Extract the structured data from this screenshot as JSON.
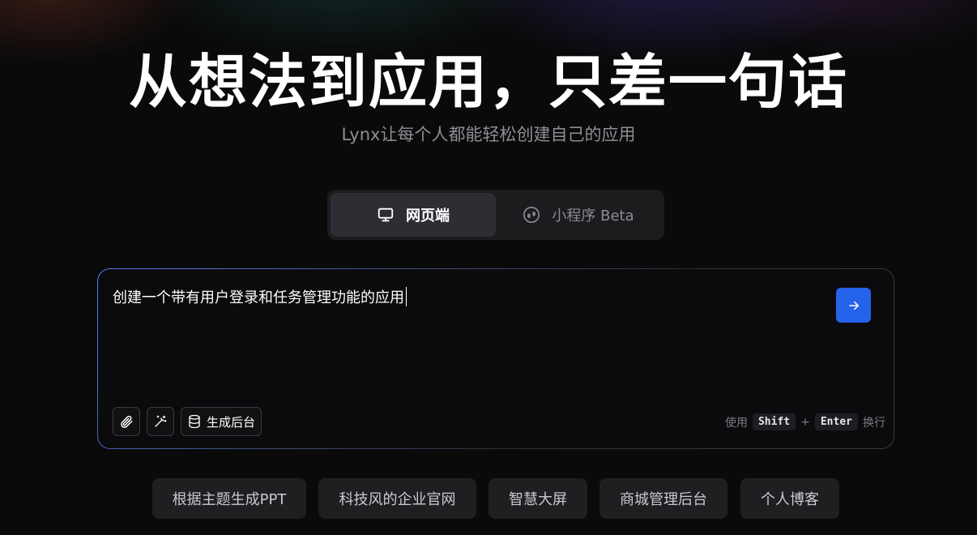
{
  "hero": {
    "title": "从想法到应用，只差一句话",
    "subtitle": "Lynx让每个人都能轻松创建自己的应用"
  },
  "mode_switch": {
    "tabs": [
      {
        "label": "网页端",
        "icon": "monitor-icon",
        "active": true
      },
      {
        "label": "小程序 Beta",
        "icon": "miniprogram-icon",
        "active": false
      }
    ]
  },
  "prompt": {
    "value": "创建一个带有用户登录和任务管理功能的应用",
    "tools": [
      {
        "icon": "paperclip-icon",
        "label": ""
      },
      {
        "icon": "magic-wand-icon",
        "label": ""
      },
      {
        "icon": "database-icon",
        "label": "生成后台"
      }
    ],
    "hint": {
      "prefix": "使用",
      "key1": "Shift",
      "plus": "+",
      "key2": "Enter",
      "suffix": "换行"
    }
  },
  "suggestions": [
    "根据主题生成PPT",
    "科技风的企业官网",
    "智慧大屏",
    "商城管理后台",
    "个人博客"
  ],
  "colors": {
    "accent": "#2563eb",
    "background": "#0a0a0b"
  }
}
